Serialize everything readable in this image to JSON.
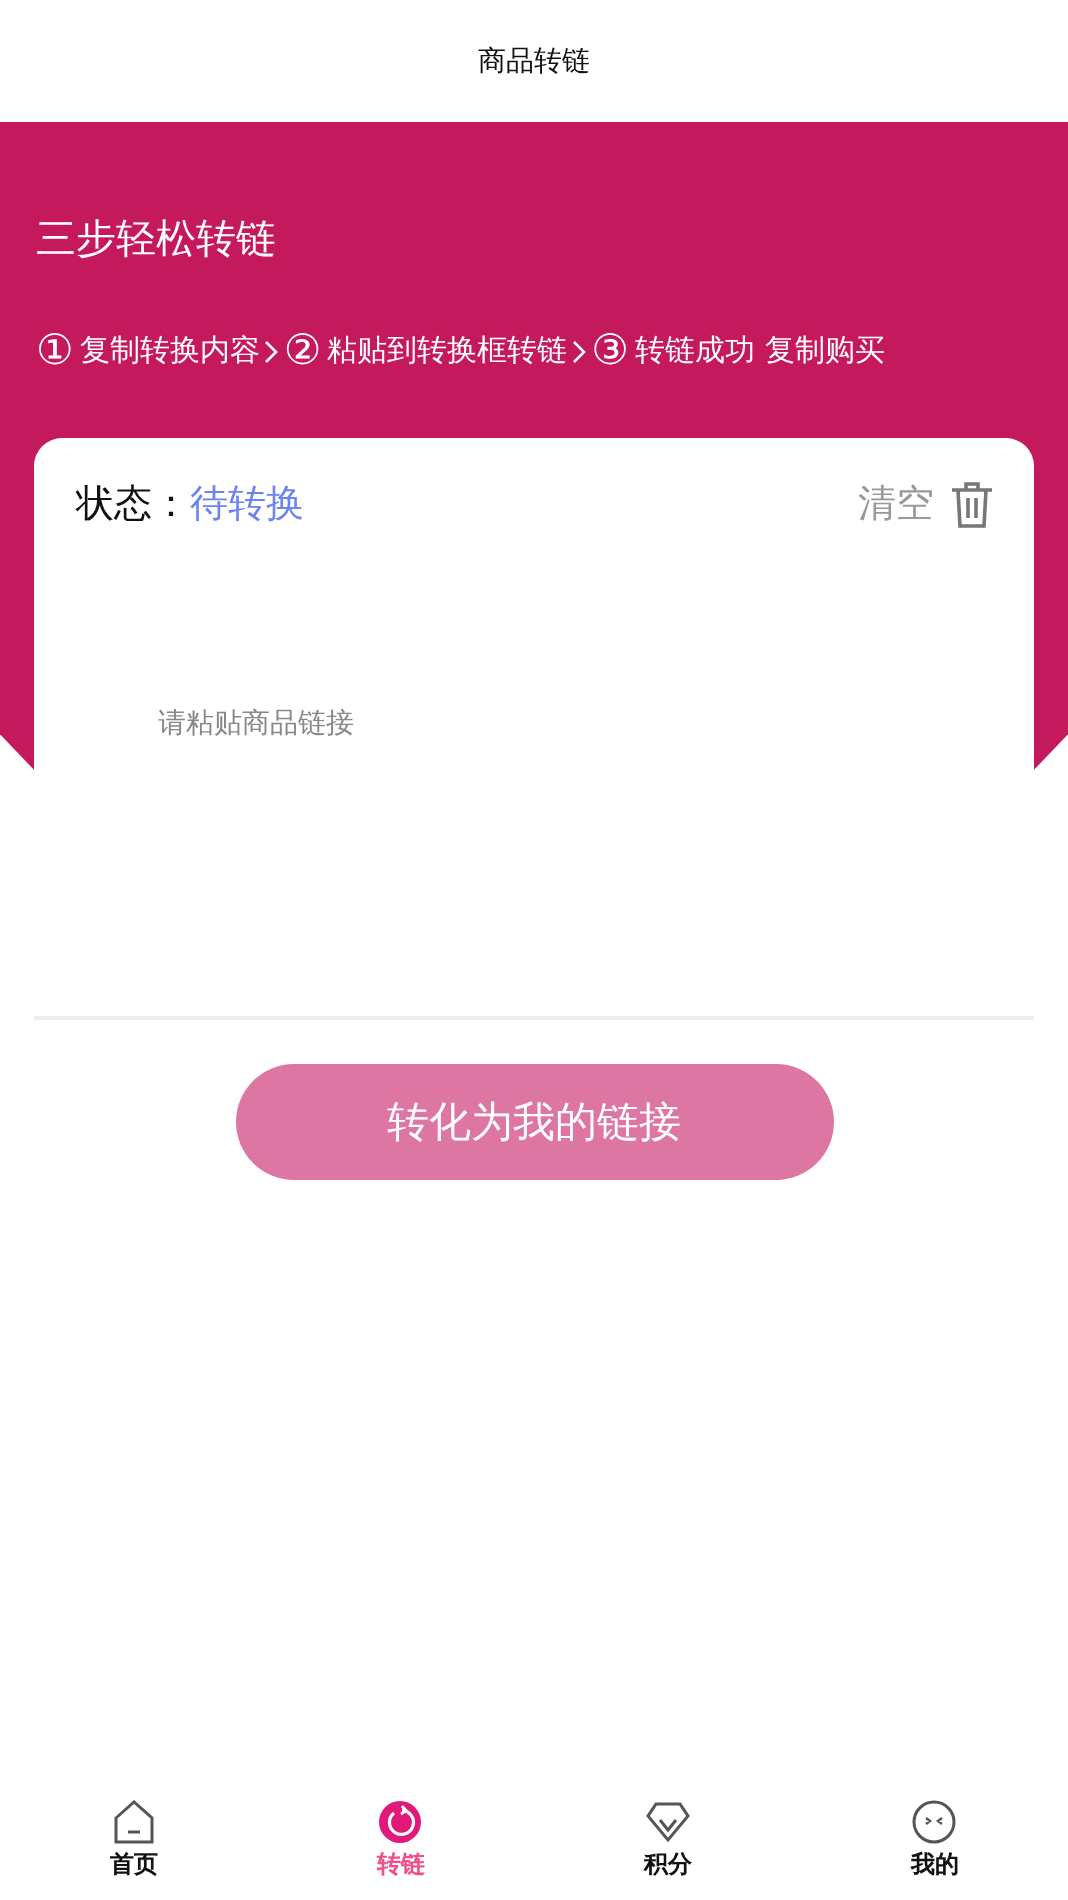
{
  "window": {
    "title": "商品转链"
  },
  "hero": {
    "title": "三步轻松转链",
    "steps": [
      {
        "number": "①",
        "label": "复制转换内容"
      },
      {
        "number": "②",
        "label": "粘贴到转换框转链"
      },
      {
        "number": "③",
        "label": "转链成功 复制购买"
      }
    ]
  },
  "card": {
    "status_label": "状态：",
    "status_value": "待转换",
    "clear_label": "清空",
    "input": {
      "placeholder": "请粘贴商品链接"
    }
  },
  "convert_button": "转化为我的链接",
  "tabs": [
    {
      "kind": "home",
      "label": "首页",
      "selected": false
    },
    {
      "kind": "convert",
      "label": "转链",
      "selected": true
    },
    {
      "kind": "points",
      "label": "积分",
      "selected": false
    },
    {
      "kind": "mine",
      "label": "我的",
      "selected": false
    }
  ]
}
